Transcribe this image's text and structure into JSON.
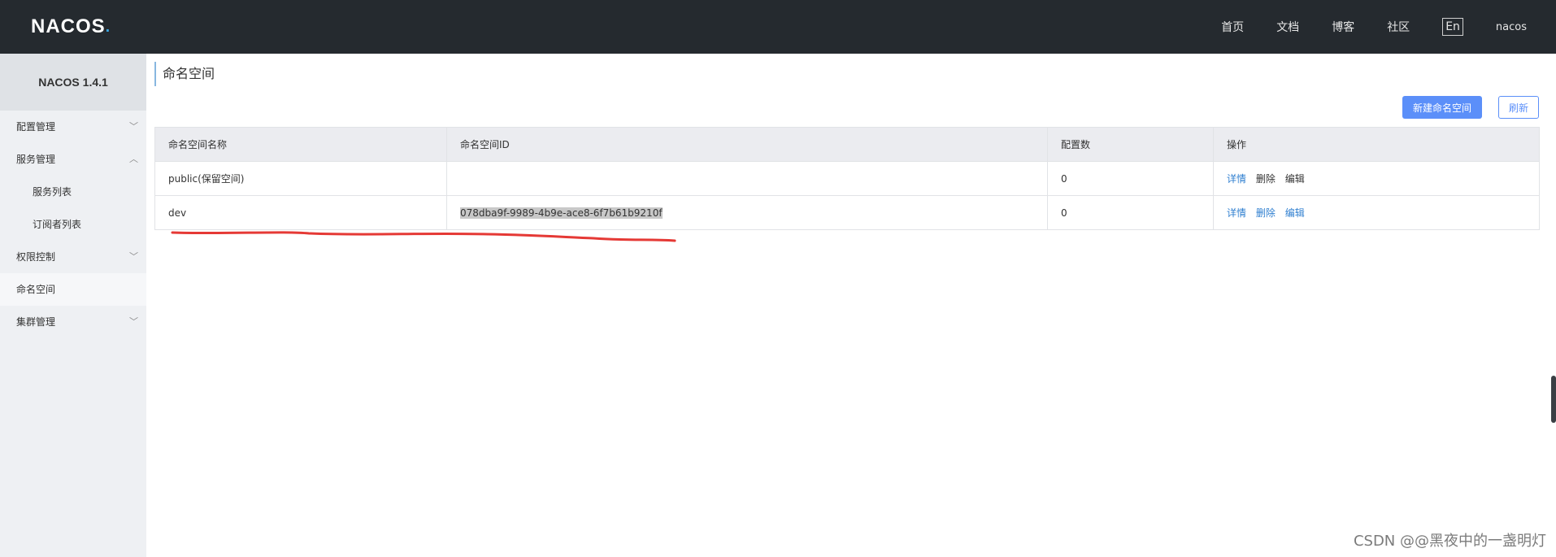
{
  "header": {
    "logo_text": "NACOS",
    "nav": [
      "首页",
      "文档",
      "博客",
      "社区"
    ],
    "lang": "En",
    "user": "nacos"
  },
  "sidebar": {
    "version": "NACOS 1.4.1",
    "items": [
      {
        "label": "配置管理",
        "chevron": "chevron-down-icon"
      },
      {
        "label": "服务管理",
        "chevron": "chevron-up-icon"
      },
      {
        "label": "服务列表"
      },
      {
        "label": "订阅者列表"
      },
      {
        "label": "权限控制",
        "chevron": "chevron-down-icon"
      },
      {
        "label": "命名空间"
      },
      {
        "label": "集群管理",
        "chevron": "chevron-down-icon"
      }
    ]
  },
  "main": {
    "title": "命名空间",
    "new_button": "新建命名空间",
    "refresh_button": "刷新",
    "table": {
      "headers": [
        "命名空间名称",
        "命名空间ID",
        "配置数",
        "操作"
      ],
      "rows": [
        {
          "name": "public(保留空间)",
          "id": "",
          "count": "0",
          "ops": [
            "详情",
            "删除",
            "编辑"
          ]
        },
        {
          "name": "dev",
          "id": "078dba9f-9989-4b9e-ace8-6f7b61b9210f",
          "count": "0",
          "ops": [
            "详情",
            "删除",
            "编辑"
          ]
        }
      ]
    }
  },
  "watermark": "CSDN @@黑夜中的一盏明灯",
  "colors": {
    "topbar": "#252a2f",
    "primary": "#5b8ff9",
    "link": "#2f7fd0",
    "annotation": "#e53935"
  }
}
